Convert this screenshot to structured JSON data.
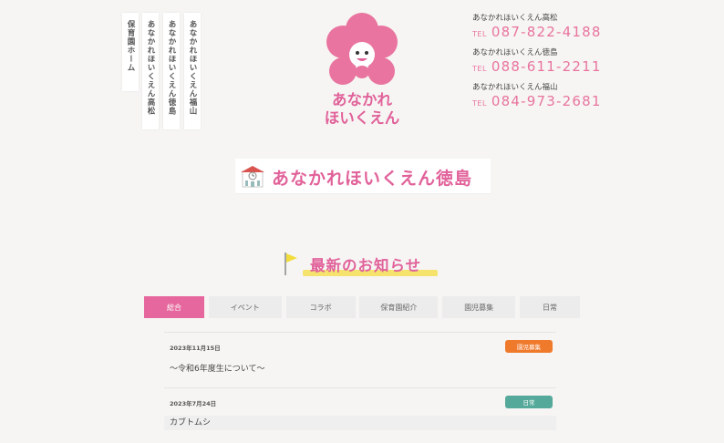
{
  "nav": {
    "items": [
      {
        "label": "保育園ホーム"
      },
      {
        "label": "あなかれほいくえん高松"
      },
      {
        "label": "あなかれほいくえん徳島"
      },
      {
        "label": "あなかれほいくえん福山"
      }
    ]
  },
  "logo": {
    "line1": "あなかれ",
    "line2": "ほいくえん",
    "colors": {
      "pink": "#e1629a",
      "pink_light": "#e9749f"
    }
  },
  "branches": [
    {
      "name": "あなかれほいくえん高松",
      "tel_label": "TEL",
      "tel": "087-822-4188"
    },
    {
      "name": "あなかれほいくえん徳島",
      "tel_label": "TEL",
      "tel": "088-611-2211"
    },
    {
      "name": "あなかれほいくえん福山",
      "tel_label": "TEL",
      "tel": "084-973-2681"
    }
  ],
  "school": {
    "title": "あなかれほいくえん徳島",
    "icon": "school-building-icon"
  },
  "news": {
    "heading": "最新のお知らせ",
    "tabs": [
      {
        "label": "総合",
        "active": true
      },
      {
        "label": "イベント"
      },
      {
        "label": "コラボ"
      },
      {
        "label": "保育園紹介"
      },
      {
        "label": "園児募集"
      },
      {
        "label": "日常"
      }
    ],
    "items": [
      {
        "date": "2023年11月15日",
        "badge": "園児募集",
        "badge_color": "#f07a2c",
        "text": "〜令和6年度生について〜"
      },
      {
        "date": "2023年7月24日",
        "badge": "日常",
        "badge_color": "#55a99a",
        "text": "カブトムシ"
      }
    ]
  }
}
